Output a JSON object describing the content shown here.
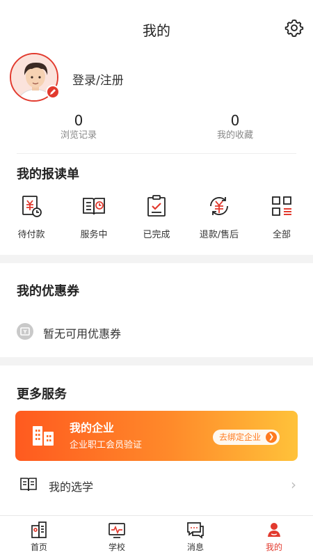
{
  "header": {
    "title": "我的",
    "settings_icon": "gear-icon"
  },
  "profile": {
    "login_text": "登录/注册",
    "avatar_icon": "avatar",
    "badge_icon": "edit-badge-icon"
  },
  "stats": [
    {
      "value": "0",
      "label": "浏览记录"
    },
    {
      "value": "0",
      "label": "我的收藏"
    }
  ],
  "orders": {
    "title": "我的报读单",
    "items": [
      {
        "label": "待付款",
        "icon": "pending-payment-icon"
      },
      {
        "label": "服务中",
        "icon": "in-service-icon"
      },
      {
        "label": "已完成",
        "icon": "completed-icon"
      },
      {
        "label": "退款/售后",
        "icon": "refund-icon"
      },
      {
        "label": "全部",
        "icon": "all-orders-icon"
      }
    ]
  },
  "coupons": {
    "title": "我的优惠券",
    "empty_text": "暂无可用优惠券",
    "icon": "coupon-icon"
  },
  "more_services": {
    "title": "更多服务",
    "enterprise": {
      "title": "我的企业",
      "subtitle": "企业职工会员验证",
      "button": "去绑定企业"
    },
    "items": [
      {
        "label": "我的选学",
        "icon": "book-icon"
      }
    ]
  },
  "tabbar": [
    {
      "label": "首页",
      "icon": "home-icon",
      "active": false
    },
    {
      "label": "学校",
      "icon": "school-icon",
      "active": false
    },
    {
      "label": "消息",
      "icon": "message-icon",
      "active": false
    },
    {
      "label": "我的",
      "icon": "me-icon",
      "active": true
    }
  ],
  "colors": {
    "accent": "#e23a2e",
    "gradient_start": "#ff5a1f",
    "gradient_end": "#ffc23a",
    "section_gap": "#f3f3f3"
  }
}
